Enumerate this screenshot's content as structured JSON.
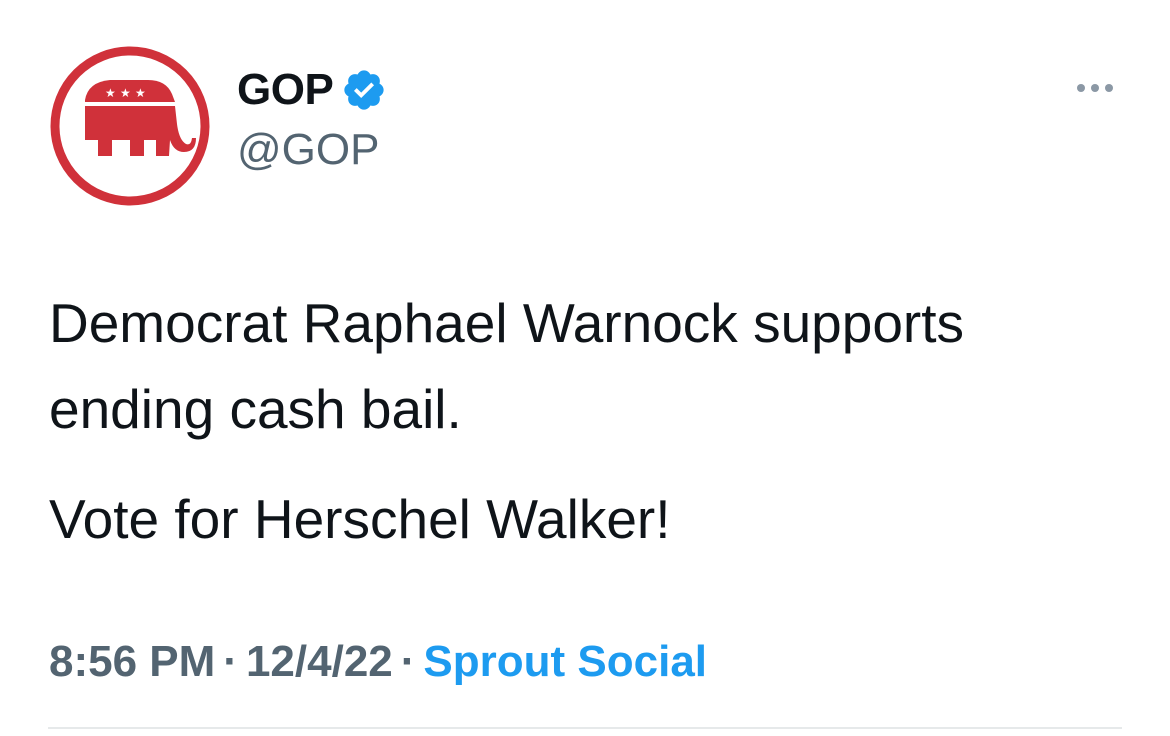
{
  "tweet": {
    "author": {
      "display_name": "GOP",
      "handle": "@GOP",
      "verified": true,
      "avatar_icon": "gop-elephant-logo-icon",
      "verified_icon": "verified-badge-icon"
    },
    "more_icon": "more-options-icon",
    "text_paragraphs": [
      "Democrat Raphael Warnock supports ending cash bail.",
      "Vote for Herschel Walker!"
    ],
    "meta": {
      "time": "8:56 PM",
      "separator": "·",
      "date": "12/4/22",
      "source": "Sprout Social"
    }
  },
  "colors": {
    "text": "#0f1419",
    "secondary_text": "#536471",
    "link": "#1d9bf0",
    "logo_red": "#d0313a",
    "verified_blue": "#1d9bf0",
    "divider": "#e6e9ea"
  }
}
